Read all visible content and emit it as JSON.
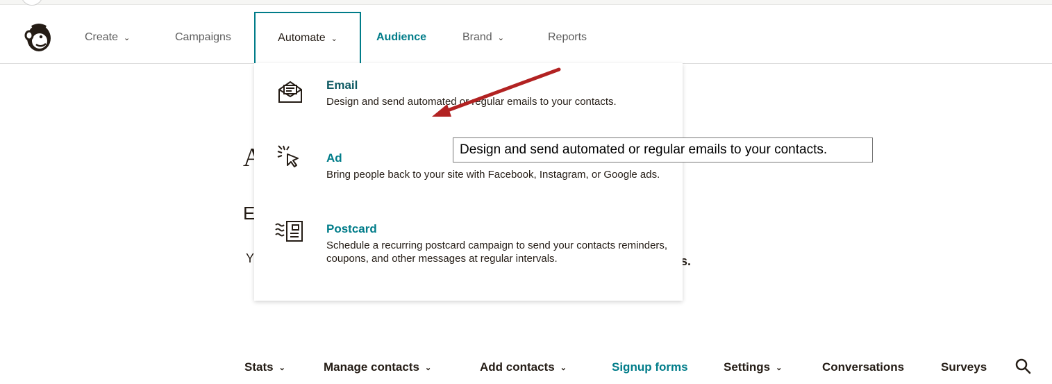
{
  "nav": {
    "create": "Create",
    "campaigns": "Campaigns",
    "automate": "Automate",
    "audience": "Audience",
    "brand": "Brand",
    "reports": "Reports",
    "chevron": "⌄"
  },
  "dropdown": {
    "items": [
      {
        "title": "Email",
        "description": "Design and send automated or regular emails to your contacts.",
        "icon": "envelope-icon"
      },
      {
        "title": "Ad",
        "description": "Bring people back to your site with Facebook, Instagram, or Google ads.",
        "icon": "cursor-click-icon"
      },
      {
        "title": "Postcard",
        "description": "Schedule a recurring postcard campaign to send your contacts reminders, coupons, and other messages at regular intervals.",
        "icon": "postcard-icon"
      }
    ]
  },
  "tooltip": "Design and send automated or regular emails to your contacts.",
  "background": {
    "a": "A",
    "e": "E",
    "y": "Y",
    "s": "s."
  },
  "subnav": {
    "stats": "Stats",
    "manage_contacts": "Manage contacts",
    "add_contacts": "Add contacts",
    "signup_forms": "Signup forms",
    "settings": "Settings",
    "conversations": "Conversations",
    "surveys": "Surveys"
  },
  "colors": {
    "accent": "#007c89",
    "annotation_arrow": "#b22222"
  }
}
